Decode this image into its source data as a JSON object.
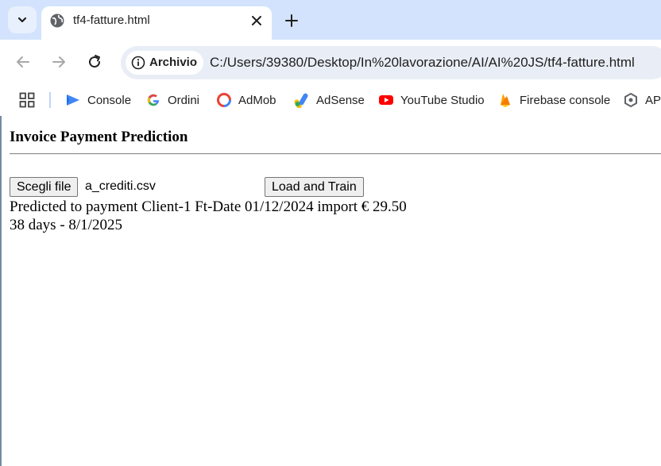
{
  "browser": {
    "tab": {
      "title": "tf4-fatture.html"
    },
    "site_chip": {
      "label": "Archivio"
    },
    "url": "C:/Users/39380/Desktop/In%20lavorazione/AI/AI%20JS/tf4-fatture.html",
    "bookmarks": [
      {
        "label": "Console",
        "icon": "console-icon"
      },
      {
        "label": "Ordini",
        "icon": "google-icon"
      },
      {
        "label": "AdMob",
        "icon": "admob-icon"
      },
      {
        "label": "AdSense",
        "icon": "adsense-icon"
      },
      {
        "label": "YouTube Studio",
        "icon": "youtube-icon"
      },
      {
        "label": "Firebase console",
        "icon": "firebase-icon"
      },
      {
        "label": "API",
        "icon": "api-icon"
      }
    ]
  },
  "page": {
    "title": "Invoice Payment Prediction",
    "file_button": "Scegli file",
    "file_name": "a_crediti.csv",
    "load_button": "Load and Train",
    "result_line1": "Predicted to payment Client-1 Ft-Date 01/12/2024 import € 29.50",
    "result_line2": "38 days - 8/1/2025"
  },
  "colors": {
    "tabstrip": "#d3e3fd",
    "omnibox": "#e9eef6",
    "button_bg": "#efefef"
  }
}
